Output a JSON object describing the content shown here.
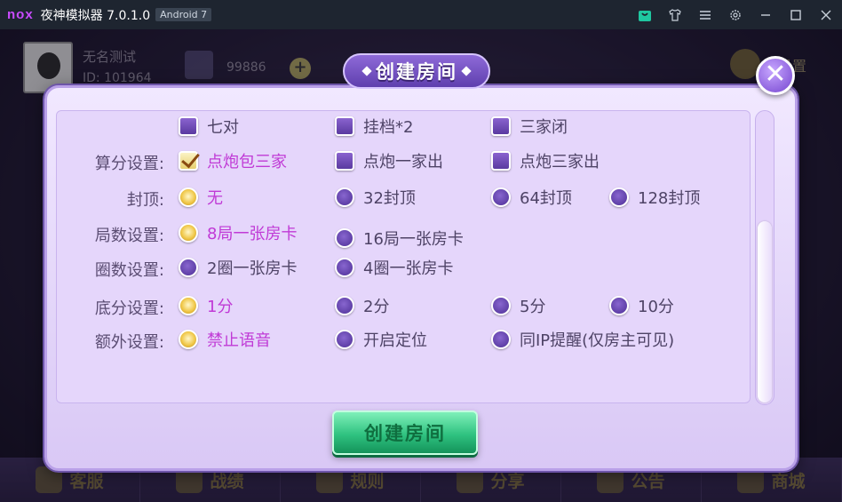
{
  "emulator": {
    "logo": "nox",
    "title": "夜神模拟器 7.0.1.0",
    "android_badge": "Android 7",
    "icons": [
      "store-icon",
      "shirt-icon",
      "menu-icon",
      "gear-icon",
      "minimize-icon",
      "maximize-icon",
      "close-icon"
    ]
  },
  "background": {
    "player_name": "无名测试",
    "player_id": "ID: 101964",
    "room_cards": "99886",
    "settings_label": "设置",
    "bottom_nav": [
      "客服",
      "战绩",
      "规则",
      "分享",
      "公告",
      "商城"
    ]
  },
  "dialog": {
    "title": "创建房间",
    "create_button": "创建房间",
    "rows": [
      {
        "label": "",
        "type": "checkbox",
        "options": [
          {
            "text": "七对",
            "checked": false
          },
          {
            "text": "挂档*2",
            "checked": false
          },
          {
            "text": "三家闭",
            "checked": false
          }
        ]
      },
      {
        "label": "算分设置:",
        "type": "checkbox",
        "options": [
          {
            "text": "点炮包三家",
            "checked": true
          },
          {
            "text": "点炮一家出",
            "checked": false
          },
          {
            "text": "点炮三家出",
            "checked": false
          }
        ]
      },
      {
        "label": "封顶:",
        "type": "radio",
        "options": [
          {
            "text": "无",
            "checked": true
          },
          {
            "text": "32封顶",
            "checked": false
          },
          {
            "text": "64封顶",
            "checked": false
          },
          {
            "text": "128封顶",
            "checked": false
          }
        ]
      },
      {
        "label": "局数设置:",
        "type": "radio",
        "options": [
          {
            "text": "8局一张房卡",
            "checked": true
          },
          {
            "text": "16局一张房卡",
            "checked": false
          }
        ]
      },
      {
        "label": "圈数设置:",
        "type": "radio",
        "options": [
          {
            "text": "2圈一张房卡",
            "checked": false
          },
          {
            "text": "4圈一张房卡",
            "checked": false
          }
        ]
      },
      {
        "label": "底分设置:",
        "type": "radio",
        "options": [
          {
            "text": "1分",
            "checked": true
          },
          {
            "text": "2分",
            "checked": false
          },
          {
            "text": "5分",
            "checked": false
          },
          {
            "text": "10分",
            "checked": false
          }
        ]
      },
      {
        "label": "额外设置:",
        "type": "radio",
        "options": [
          {
            "text": "禁止语音",
            "checked": true
          },
          {
            "text": "开启定位",
            "checked": false
          },
          {
            "text": "同IP提醒(仅房主可见)",
            "checked": false
          }
        ]
      }
    ]
  }
}
